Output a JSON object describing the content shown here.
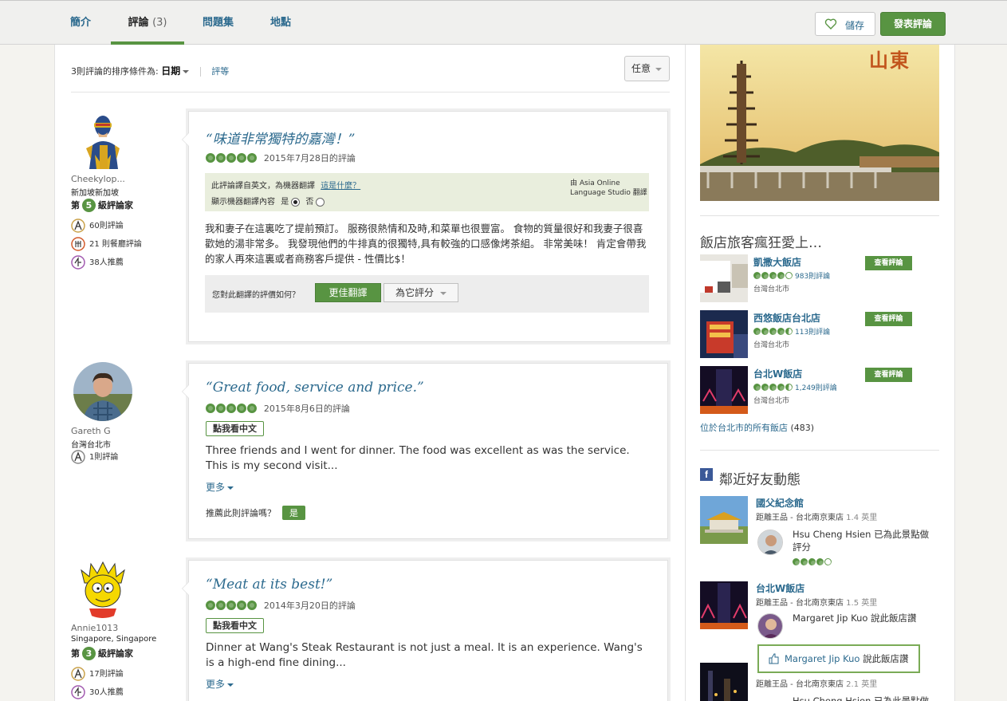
{
  "tabs": [
    {
      "label": "簡介"
    },
    {
      "label": "評論",
      "count": "(3)"
    },
    {
      "label": "問題集"
    },
    {
      "label": "地點"
    }
  ],
  "header": {
    "save_label": "儲存",
    "write_review_label": "發表評論"
  },
  "sort": {
    "prefix": "3則評論的排序條件為:",
    "date": "日期",
    "rating": "評等",
    "language": "任意"
  },
  "reviews": [
    {
      "user": "Cheekylop...",
      "location": "新加坡新加坡",
      "level_prefix": "第",
      "level": "5",
      "level_suffix": "級評論家",
      "stats": [
        "60則評論",
        "21 則餐廳評論",
        "38人推薦"
      ],
      "title": "“味道非常獨特的嘉灣！”",
      "rating": 5,
      "date": "2015年7月28日的評論",
      "mt_notice": "此評論譯自英文，為機器翻譯",
      "mt_link": "這是什麼？",
      "mt_show": "顯示機器翻譯內容",
      "mt_yes": "是",
      "mt_no": "否",
      "mt_credit_1": "由 Asia Online",
      "mt_credit_2": "Language Studio 翻譯",
      "body": "我和妻子在這裏吃了提前預訂。 服務很熱情和及時,和菜單也很豐富。 食物的質量很好和我妻子很喜歡她的湯非常多。 我發現他們的牛排真的很獨特,具有較強的口感像烤茶組。 非常美味！ 肯定會帶我的家人再來這裏或者商務客戶提供 - 性價比$！",
      "rate_question": "您對此翻譯的評價如何？",
      "better_btn": "更佳翻譯",
      "rate_btn": "為它評分"
    },
    {
      "user": "Gareth G",
      "location": "台灣台北市",
      "stats": [
        "1則評論"
      ],
      "title": "“Great food, service and price.”",
      "rating": 5,
      "date": "2015年8月6日的評論",
      "translate_btn": "點我看中文",
      "body": "Three friends and I went for dinner. The food was excellent as was the service. This is my second visit...",
      "more": "更多",
      "helpful_q": "推薦此則評論嗎？",
      "helpful_yes": "是"
    },
    {
      "user": "Annie1013",
      "location": "Singapore, Singapore",
      "level_prefix": "第",
      "level": "3",
      "level_suffix": "級評論家",
      "stats": [
        "17則評論",
        "30人推薦"
      ],
      "title": "“Meat at its best!”",
      "rating": 5,
      "date": "2014年3月20日的評論",
      "translate_btn": "點我看中文",
      "body": "Dinner at Wang's Steak Restaurant is not just a meal. It is an experience. Wang's is a high-end fine dining...",
      "more": "更多"
    }
  ],
  "sidebar": {
    "ad_text": "山東",
    "hotels_title": "飯店旅客瘋狂愛上…",
    "hotels": [
      {
        "name": "凱撒大飯店",
        "rating": 4,
        "count": "983則評論",
        "location": "台灣台北市",
        "button": "查看評論"
      },
      {
        "name": "西悠飯店台北店",
        "rating": 4.5,
        "count": "113則評論",
        "location": "台灣台北市",
        "button": "查看評論"
      },
      {
        "name": "台北W飯店",
        "rating": 4.5,
        "count": "1,249則評論",
        "location": "台灣台北市",
        "button": "查看評論"
      }
    ],
    "all_hotels": "位於台北市的所有飯店",
    "all_hotels_count": "(483)",
    "friends_title": "鄰近好友動態",
    "friends": [
      {
        "name": "國父紀念館",
        "dist_prefix": "距離王品 - 台北南京東店",
        "dist": "1.4 英里",
        "activity": "Hsu Cheng Hsien 已為此景點做評分",
        "rating": 4
      },
      {
        "name": "台北W飯店",
        "dist_prefix": "距離王品 - 台北南京東店",
        "dist": "1.5 英里",
        "activity": "Margaret Jip Kuo 說此飯店讚"
      },
      {
        "name": "",
        "dist_prefix": "距離王品 - 台北南京東店",
        "dist": "2.1 英里",
        "activity": "Hsu Cheng Hsien 已為此景點做"
      }
    ],
    "tooltip_name": "Margaret Jip Kuo",
    "tooltip_said": "說此飯店讚"
  },
  "colors": {
    "brand_green": "#589442",
    "link_blue": "#2c6a8e"
  }
}
